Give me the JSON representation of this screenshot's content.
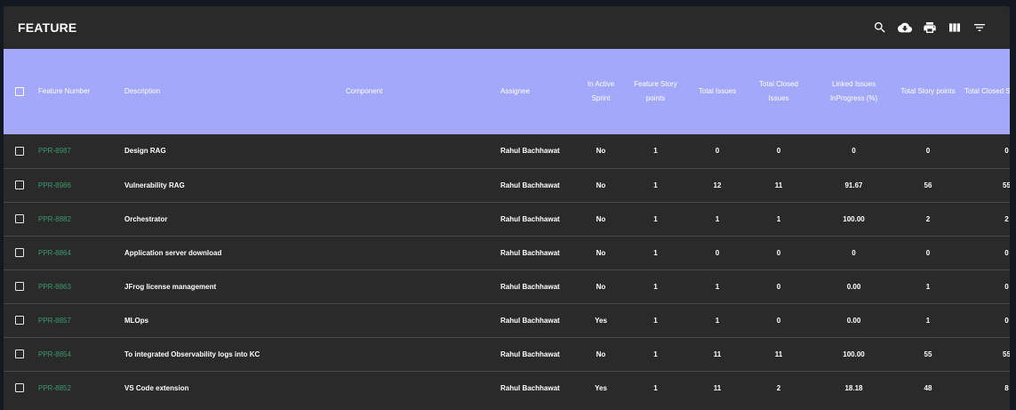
{
  "title": "FEATURE",
  "tools": [
    "search-icon",
    "cloud-download-icon",
    "print-icon",
    "view-columns-icon",
    "filter-icon"
  ],
  "columns": [
    {
      "key": "select",
      "label": ""
    },
    {
      "key": "feature_number",
      "label": "Feature Number"
    },
    {
      "key": "description",
      "label": "Description"
    },
    {
      "key": "component",
      "label": "Component"
    },
    {
      "key": "assignee",
      "label": "Assignee"
    },
    {
      "key": "in_active_sprint",
      "label": "In Active Sprint"
    },
    {
      "key": "feature_story_points",
      "label": "Feature Story points"
    },
    {
      "key": "total_issues",
      "label": "Total Issues"
    },
    {
      "key": "total_closed_issues",
      "label": "Total Closed Issues"
    },
    {
      "key": "linked_issues_inprogress",
      "label": "Linked Issues InProgress (%)"
    },
    {
      "key": "total_story_points",
      "label": "Total Story points"
    },
    {
      "key": "total_closed_story_points",
      "label": "Total Closed Story points"
    }
  ],
  "rows": [
    {
      "feature_number": "PPR-8987",
      "description": "Design RAG",
      "component": "",
      "assignee": "Rahul Bachhawat",
      "in_active_sprint": "No",
      "feature_story_points": "1",
      "total_issues": "0",
      "total_closed_issues": "0",
      "linked_issues_inprogress": "0",
      "total_story_points": "0",
      "total_closed_story_points": "0"
    },
    {
      "feature_number": "PPR-8986",
      "description": "Vulnerability RAG",
      "component": "",
      "assignee": "Rahul Bachhawat",
      "in_active_sprint": "No",
      "feature_story_points": "1",
      "total_issues": "12",
      "total_closed_issues": "11",
      "linked_issues_inprogress": "91.67",
      "total_story_points": "56",
      "total_closed_story_points": "55"
    },
    {
      "feature_number": "PPR-8882",
      "description": "Orchestrator",
      "component": "",
      "assignee": "Rahul Bachhawat",
      "in_active_sprint": "No",
      "feature_story_points": "1",
      "total_issues": "1",
      "total_closed_issues": "1",
      "linked_issues_inprogress": "100.00",
      "total_story_points": "2",
      "total_closed_story_points": "2"
    },
    {
      "feature_number": "PPR-8864",
      "description": "Application server download",
      "component": "",
      "assignee": "Rahul Bachhawat",
      "in_active_sprint": "No",
      "feature_story_points": "1",
      "total_issues": "0",
      "total_closed_issues": "0",
      "linked_issues_inprogress": "0",
      "total_story_points": "0",
      "total_closed_story_points": "0"
    },
    {
      "feature_number": "PPR-8863",
      "description": "JFrog license management",
      "component": "",
      "assignee": "Rahul Bachhawat",
      "in_active_sprint": "No",
      "feature_story_points": "1",
      "total_issues": "1",
      "total_closed_issues": "0",
      "linked_issues_inprogress": "0.00",
      "total_story_points": "1",
      "total_closed_story_points": "0"
    },
    {
      "feature_number": "PPR-8857",
      "description": "MLOps",
      "component": "",
      "assignee": "Rahul Bachhawat",
      "in_active_sprint": "Yes",
      "feature_story_points": "1",
      "total_issues": "1",
      "total_closed_issues": "0",
      "linked_issues_inprogress": "0.00",
      "total_story_points": "1",
      "total_closed_story_points": "0"
    },
    {
      "feature_number": "PPR-8854",
      "description": "To integrated Observability logs into KC",
      "component": "",
      "assignee": "Rahul Bachhawat",
      "in_active_sprint": "No",
      "feature_story_points": "1",
      "total_issues": "11",
      "total_closed_issues": "11",
      "linked_issues_inprogress": "100.00",
      "total_story_points": "55",
      "total_closed_story_points": "55"
    },
    {
      "feature_number": "PPR-8852",
      "description": "VS Code extension",
      "component": "",
      "assignee": "Rahul Bachhawat",
      "in_active_sprint": "Yes",
      "feature_story_points": "1",
      "total_issues": "11",
      "total_closed_issues": "2",
      "linked_issues_inprogress": "18.18",
      "total_story_points": "48",
      "total_closed_story_points": "8"
    }
  ]
}
